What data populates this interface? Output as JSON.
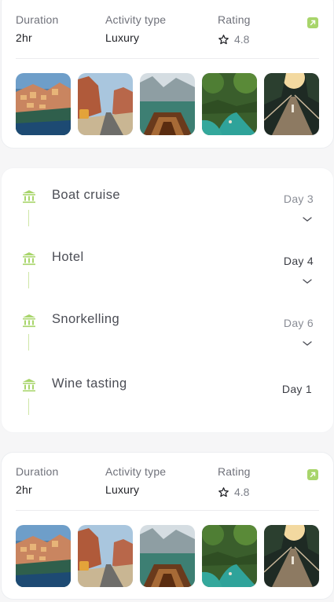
{
  "cards": [
    {
      "duration_label": "Duration",
      "duration_value": "2hr",
      "activity_label": "Activity type",
      "activity_value": "Luxury",
      "rating_label": "Rating",
      "rating_value": "4.8",
      "rating_icon": "star-outline-icon",
      "link_icon": "external-link-icon",
      "photos": [
        "coastal-village-photo",
        "canyon-road-photo",
        "lake-boat-photo",
        "jungle-river-photo",
        "suspension-bridge-photo"
      ]
    },
    {
      "duration_label": "Duration",
      "duration_value": "2hr",
      "activity_label": "Activity type",
      "activity_value": "Luxury",
      "rating_label": "Rating",
      "rating_value": "4.8",
      "rating_icon": "star-outline-icon",
      "link_icon": "external-link-icon",
      "photos": [
        "coastal-village-photo",
        "canyon-road-photo",
        "lake-boat-photo",
        "jungle-river-photo",
        "suspension-bridge-photo"
      ]
    }
  ],
  "timeline": {
    "items": [
      {
        "title": "Boat cruise",
        "day": "Day 3",
        "icon": "landmark-icon",
        "expandable": true
      },
      {
        "title": "Hotel",
        "day": "Day 4",
        "icon": "landmark-icon",
        "expandable": true
      },
      {
        "title": "Snorkelling",
        "day": "Day 6",
        "icon": "landmark-icon",
        "expandable": true
      },
      {
        "title": "Wine tasting",
        "day": "Day 1",
        "icon": "landmark-icon",
        "expandable": false
      }
    ]
  },
  "colors": {
    "accent": "#a8d56b",
    "accent_line": "#cfe6a7",
    "text_muted": "#6f717a",
    "card_bg": "#ffffff",
    "page_bg": "#f6f6f7"
  }
}
